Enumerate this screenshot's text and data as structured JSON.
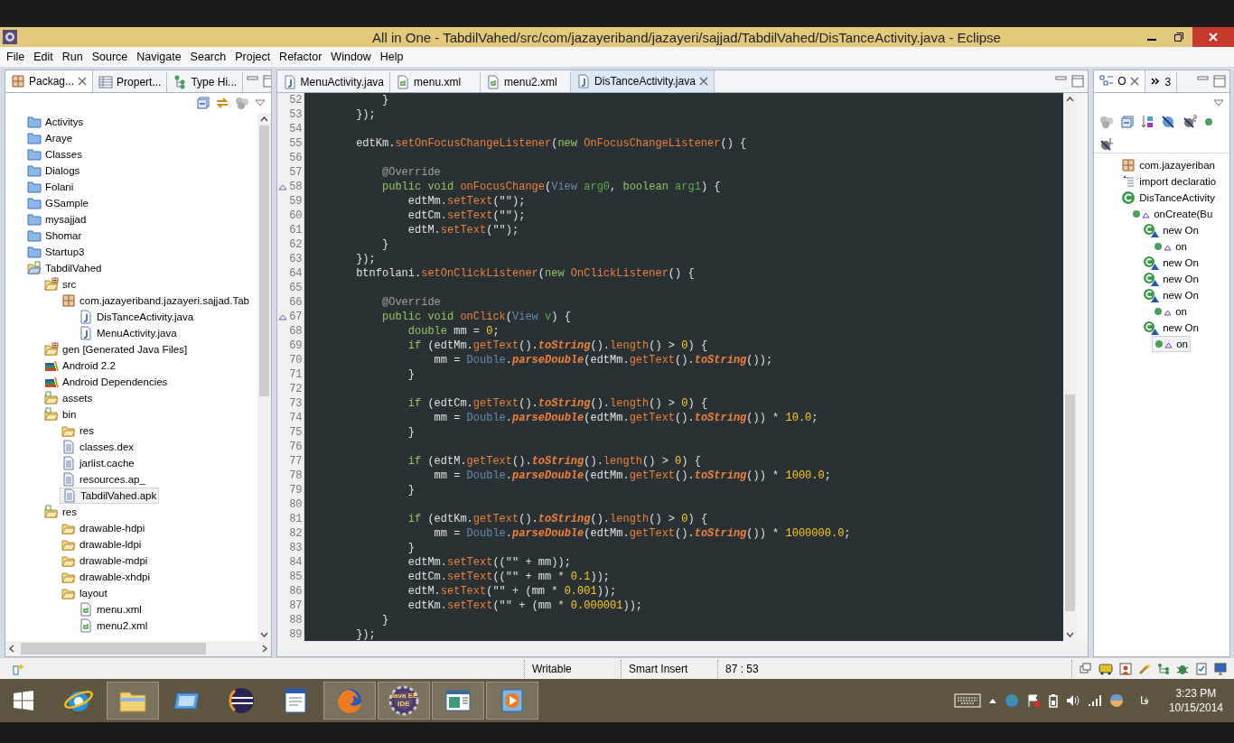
{
  "window": {
    "title": "All in One - TabdilVahed/src/com/jazayeriband/jazayeri/sajjad/TabdilVahed/DisTanceActivity.java - Eclipse",
    "menu": [
      "File",
      "Edit",
      "Run",
      "Source",
      "Navigate",
      "Search",
      "Project",
      "Refactor",
      "Window",
      "Help"
    ]
  },
  "package_explorer": {
    "tabs": [
      {
        "label": "Packag...",
        "kind": "package",
        "selected": true
      },
      {
        "label": "Propert...",
        "kind": "table",
        "selected": false
      },
      {
        "label": "Type Hi...",
        "kind": "hierarchy",
        "selected": false
      }
    ],
    "items": [
      {
        "label": "Activitys",
        "kind": "folder",
        "selected": false
      },
      {
        "label": "Araye",
        "kind": "folder",
        "selected": false
      },
      {
        "label": "Classes",
        "kind": "folder",
        "selected": false
      },
      {
        "label": "Dialogs",
        "kind": "folder",
        "selected": false
      },
      {
        "label": "Folani",
        "kind": "folder",
        "selected": false
      },
      {
        "label": "GSample",
        "kind": "folder",
        "selected": false
      },
      {
        "label": "mysajjad",
        "kind": "folder",
        "selected": false
      },
      {
        "label": "Shomar",
        "kind": "folder",
        "selected": false
      },
      {
        "label": "Startup3",
        "kind": "folder",
        "selected": false
      },
      {
        "label": "TabdilVahed",
        "kind": "project",
        "selected": false,
        "children": [
          {
            "label": "src",
            "kind": "source",
            "selected": false,
            "children": [
              {
                "label": "com.jazayeriband.jazayeri.sajjad.Tab",
                "kind": "package",
                "selected": false,
                "children": [
                  {
                    "label": "DisTanceActivity.java",
                    "kind": "java",
                    "selected": false
                  },
                  {
                    "label": "MenuActivity.java",
                    "kind": "java",
                    "selected": false
                  }
                ]
              }
            ]
          },
          {
            "label": "gen [Generated Java Files]",
            "kind": "source",
            "selected": false
          },
          {
            "label": "Android 2.2",
            "kind": "library",
            "selected": false
          },
          {
            "label": "Android Dependencies",
            "kind": "library",
            "selected": false
          },
          {
            "label": "assets",
            "kind": "resource-folder",
            "selected": false
          },
          {
            "label": "bin",
            "kind": "resource-folder",
            "selected": false,
            "children": [
              {
                "label": "res",
                "kind": "open-folder",
                "selected": false
              },
              {
                "label": "classes.dex",
                "kind": "file",
                "selected": false
              },
              {
                "label": "jarlist.cache",
                "kind": "file",
                "selected": false
              },
              {
                "label": "resources.ap_",
                "kind": "file",
                "selected": false
              },
              {
                "label": "TabdilVahed.apk",
                "kind": "file",
                "selected": true
              }
            ]
          },
          {
            "label": "res",
            "kind": "resource-folder",
            "selected": false,
            "children": [
              {
                "label": "drawable-hdpi",
                "kind": "open-folder",
                "selected": false
              },
              {
                "label": "drawable-ldpi",
                "kind": "open-folder",
                "selected": false
              },
              {
                "label": "drawable-mdpi",
                "kind": "open-folder",
                "selected": false
              },
              {
                "label": "drawable-xhdpi",
                "kind": "open-folder",
                "selected": false
              },
              {
                "label": "layout",
                "kind": "open-folder",
                "selected": false,
                "children": [
                  {
                    "label": "menu.xml",
                    "kind": "xml",
                    "selected": false
                  },
                  {
                    "label": "menu2.xml",
                    "kind": "xml",
                    "selected": false
                  }
                ]
              }
            ]
          }
        ]
      }
    ]
  },
  "editor": {
    "tabs": [
      {
        "label": "MenuActivity.java",
        "kind": "java",
        "selected": false
      },
      {
        "label": "menu.xml",
        "kind": "xml",
        "selected": false
      },
      {
        "label": "menu2.xml",
        "kind": "xml",
        "selected": false
      },
      {
        "label": "DisTanceActivity.java",
        "kind": "java",
        "selected": true
      }
    ],
    "lines": [
      {
        "number": "52",
        "marker": false,
        "tokens": [
          {
            "kind": "plain",
            "text": "            }"
          }
        ]
      },
      {
        "number": "53",
        "marker": false,
        "tokens": [
          {
            "kind": "plain",
            "text": "        });"
          }
        ]
      },
      {
        "number": "54",
        "marker": false
      },
      {
        "number": "55",
        "marker": false,
        "tokens": [
          {
            "kind": "plain",
            "text": "        edtKm."
          },
          {
            "kind": "method",
            "text": "setOnFocusChangeListener"
          },
          {
            "kind": "plain",
            "text": "("
          },
          {
            "kind": "keyword",
            "text": "new "
          },
          {
            "kind": "method",
            "text": "OnFocusChangeListener"
          },
          {
            "kind": "plain",
            "text": "() {"
          }
        ]
      },
      {
        "number": "56",
        "marker": false
      },
      {
        "number": "57",
        "marker": false,
        "tokens": [
          {
            "kind": "annotation",
            "text": "            @Override"
          }
        ]
      },
      {
        "number": "58",
        "marker": true,
        "tokens": [
          {
            "kind": "keyword",
            "text": "            public void "
          },
          {
            "kind": "method",
            "text": "onFocusChange"
          },
          {
            "kind": "plain",
            "text": "("
          },
          {
            "kind": "type",
            "text": "View "
          },
          {
            "kind": "param",
            "text": "arg0"
          },
          {
            "kind": "plain",
            "text": ", "
          },
          {
            "kind": "keyword",
            "text": "boolean "
          },
          {
            "kind": "param",
            "text": "arg1"
          },
          {
            "kind": "plain",
            "text": ") {"
          }
        ]
      },
      {
        "number": "59",
        "marker": false,
        "tokens": [
          {
            "kind": "plain",
            "text": "                edtMm."
          },
          {
            "kind": "method",
            "text": "setText"
          },
          {
            "kind": "plain",
            "text": "(\"\");"
          }
        ]
      },
      {
        "number": "60",
        "marker": false,
        "tokens": [
          {
            "kind": "plain",
            "text": "                edtCm."
          },
          {
            "kind": "method",
            "text": "setText"
          },
          {
            "kind": "plain",
            "text": "(\"\");"
          }
        ]
      },
      {
        "number": "61",
        "marker": false,
        "tokens": [
          {
            "kind": "plain",
            "text": "                edtM."
          },
          {
            "kind": "method",
            "text": "setText"
          },
          {
            "kind": "plain",
            "text": "(\"\");"
          }
        ]
      },
      {
        "number": "62",
        "marker": false,
        "tokens": [
          {
            "kind": "plain",
            "text": "            }"
          }
        ]
      },
      {
        "number": "63",
        "marker": false,
        "tokens": [
          {
            "kind": "plain",
            "text": "        });"
          }
        ]
      },
      {
        "number": "64",
        "marker": false,
        "tokens": [
          {
            "kind": "plain",
            "text": "        btnfolani."
          },
          {
            "kind": "method",
            "text": "setOnClickListener"
          },
          {
            "kind": "plain",
            "text": "("
          },
          {
            "kind": "keyword",
            "text": "new "
          },
          {
            "kind": "method",
            "text": "OnClickListener"
          },
          {
            "kind": "plain",
            "text": "() {"
          }
        ]
      },
      {
        "number": "65",
        "marker": false
      },
      {
        "number": "66",
        "marker": false,
        "tokens": [
          {
            "kind": "annotation",
            "text": "            @Override"
          }
        ]
      },
      {
        "number": "67",
        "marker": true,
        "tokens": [
          {
            "kind": "keyword",
            "text": "            public void "
          },
          {
            "kind": "method",
            "text": "onClick"
          },
          {
            "kind": "plain",
            "text": "("
          },
          {
            "kind": "type",
            "text": "View "
          },
          {
            "kind": "param",
            "text": "v"
          },
          {
            "kind": "plain",
            "text": ") {"
          }
        ]
      },
      {
        "number": "68",
        "marker": false,
        "tokens": [
          {
            "kind": "keyword",
            "text": "                double"
          },
          {
            "kind": "plain",
            "text": " mm = "
          },
          {
            "kind": "number",
            "text": "0"
          },
          {
            "kind": "plain",
            "text": ";"
          }
        ]
      },
      {
        "number": "69",
        "marker": false,
        "tokens": [
          {
            "kind": "keyword",
            "text": "                if"
          },
          {
            "kind": "plain",
            "text": " (edtMm."
          },
          {
            "kind": "method",
            "text": "getText"
          },
          {
            "kind": "plain",
            "text": "()."
          },
          {
            "kind": "static",
            "text": "toString"
          },
          {
            "kind": "plain",
            "text": "()."
          },
          {
            "kind": "method",
            "text": "length"
          },
          {
            "kind": "plain",
            "text": "() > "
          },
          {
            "kind": "number",
            "text": "0"
          },
          {
            "kind": "plain",
            "text": ") {"
          }
        ]
      },
      {
        "number": "70",
        "marker": false,
        "tokens": [
          {
            "kind": "plain",
            "text": "                    mm = "
          },
          {
            "kind": "type",
            "text": "Double"
          },
          {
            "kind": "plain",
            "text": "."
          },
          {
            "kind": "static",
            "text": "parseDouble"
          },
          {
            "kind": "plain",
            "text": "(edtMm."
          },
          {
            "kind": "method",
            "text": "getText"
          },
          {
            "kind": "plain",
            "text": "()."
          },
          {
            "kind": "static",
            "text": "toString"
          },
          {
            "kind": "plain",
            "text": "());"
          }
        ]
      },
      {
        "number": "71",
        "marker": false,
        "tokens": [
          {
            "kind": "plain",
            "text": "                }"
          }
        ]
      },
      {
        "number": "72",
        "marker": false
      },
      {
        "number": "73",
        "marker": false,
        "tokens": [
          {
            "kind": "keyword",
            "text": "                if"
          },
          {
            "kind": "plain",
            "text": " (edtCm."
          },
          {
            "kind": "method",
            "text": "getText"
          },
          {
            "kind": "plain",
            "text": "()."
          },
          {
            "kind": "static",
            "text": "toString"
          },
          {
            "kind": "plain",
            "text": "()."
          },
          {
            "kind": "method",
            "text": "length"
          },
          {
            "kind": "plain",
            "text": "() > "
          },
          {
            "kind": "number",
            "text": "0"
          },
          {
            "kind": "plain",
            "text": ") {"
          }
        ]
      },
      {
        "number": "74",
        "marker": false,
        "tokens": [
          {
            "kind": "plain",
            "text": "                    mm = "
          },
          {
            "kind": "type",
            "text": "Double"
          },
          {
            "kind": "plain",
            "text": "."
          },
          {
            "kind": "static",
            "text": "parseDouble"
          },
          {
            "kind": "plain",
            "text": "(edtMm."
          },
          {
            "kind": "method",
            "text": "getText"
          },
          {
            "kind": "plain",
            "text": "()."
          },
          {
            "kind": "static",
            "text": "toString"
          },
          {
            "kind": "plain",
            "text": "()) * "
          },
          {
            "kind": "number",
            "text": "10.0"
          },
          {
            "kind": "plain",
            "text": ";"
          }
        ]
      },
      {
        "number": "75",
        "marker": false,
        "tokens": [
          {
            "kind": "plain",
            "text": "                }"
          }
        ]
      },
      {
        "number": "76",
        "marker": false
      },
      {
        "number": "77",
        "marker": false,
        "tokens": [
          {
            "kind": "keyword",
            "text": "                if"
          },
          {
            "kind": "plain",
            "text": " (edtM."
          },
          {
            "kind": "method",
            "text": "getText"
          },
          {
            "kind": "plain",
            "text": "()."
          },
          {
            "kind": "static",
            "text": "toString"
          },
          {
            "kind": "plain",
            "text": "()."
          },
          {
            "kind": "method",
            "text": "length"
          },
          {
            "kind": "plain",
            "text": "() > "
          },
          {
            "kind": "number",
            "text": "0"
          },
          {
            "kind": "plain",
            "text": ") {"
          }
        ]
      },
      {
        "number": "78",
        "marker": false,
        "tokens": [
          {
            "kind": "plain",
            "text": "                    mm = "
          },
          {
            "kind": "type",
            "text": "Double"
          },
          {
            "kind": "plain",
            "text": "."
          },
          {
            "kind": "static",
            "text": "parseDouble"
          },
          {
            "kind": "plain",
            "text": "(edtMm."
          },
          {
            "kind": "method",
            "text": "getText"
          },
          {
            "kind": "plain",
            "text": "()."
          },
          {
            "kind": "static",
            "text": "toString"
          },
          {
            "kind": "plain",
            "text": "()) * "
          },
          {
            "kind": "number",
            "text": "1000.0"
          },
          {
            "kind": "plain",
            "text": ";"
          }
        ]
      },
      {
        "number": "79",
        "marker": false,
        "tokens": [
          {
            "kind": "plain",
            "text": "                }"
          }
        ]
      },
      {
        "number": "80",
        "marker": false
      },
      {
        "number": "81",
        "marker": false,
        "tokens": [
          {
            "kind": "keyword",
            "text": "                if"
          },
          {
            "kind": "plain",
            "text": " (edtKm."
          },
          {
            "kind": "method",
            "text": "getText"
          },
          {
            "kind": "plain",
            "text": "()."
          },
          {
            "kind": "static",
            "text": "toString"
          },
          {
            "kind": "plain",
            "text": "()."
          },
          {
            "kind": "method",
            "text": "length"
          },
          {
            "kind": "plain",
            "text": "() > "
          },
          {
            "kind": "number",
            "text": "0"
          },
          {
            "kind": "plain",
            "text": ") {"
          }
        ]
      },
      {
        "number": "82",
        "marker": false,
        "tokens": [
          {
            "kind": "plain",
            "text": "                    mm = "
          },
          {
            "kind": "type",
            "text": "Double"
          },
          {
            "kind": "plain",
            "text": "."
          },
          {
            "kind": "static",
            "text": "parseDouble"
          },
          {
            "kind": "plain",
            "text": "(edtMm."
          },
          {
            "kind": "method",
            "text": "getText"
          },
          {
            "kind": "plain",
            "text": "()."
          },
          {
            "kind": "static",
            "text": "toString"
          },
          {
            "kind": "plain",
            "text": "()) * "
          },
          {
            "kind": "number",
            "text": "1000000.0"
          },
          {
            "kind": "plain",
            "text": ";"
          }
        ]
      },
      {
        "number": "83",
        "marker": false,
        "tokens": [
          {
            "kind": "plain",
            "text": "                }"
          }
        ]
      },
      {
        "number": "84",
        "marker": false,
        "tokens": [
          {
            "kind": "plain",
            "text": "                edtMm."
          },
          {
            "kind": "method",
            "text": "setText"
          },
          {
            "kind": "plain",
            "text": "((\"\" + mm));"
          }
        ]
      },
      {
        "number": "85",
        "marker": false,
        "tokens": [
          {
            "kind": "plain",
            "text": "                edtCm."
          },
          {
            "kind": "method",
            "text": "setText"
          },
          {
            "kind": "plain",
            "text": "((\"\" + mm * "
          },
          {
            "kind": "number",
            "text": "0.1"
          },
          {
            "kind": "plain",
            "text": "));"
          }
        ]
      },
      {
        "number": "86",
        "marker": false,
        "tokens": [
          {
            "kind": "plain",
            "text": "                edtM."
          },
          {
            "kind": "method",
            "text": "setText"
          },
          {
            "kind": "plain",
            "text": "(\"\" + (mm * "
          },
          {
            "kind": "number",
            "text": "0.001"
          },
          {
            "kind": "plain",
            "text": "));"
          }
        ]
      },
      {
        "number": "87",
        "marker": false,
        "tokens": [
          {
            "kind": "plain",
            "text": "                edtKm."
          },
          {
            "kind": "method",
            "text": "setText"
          },
          {
            "kind": "plain",
            "text": "(\"\" + (mm * "
          },
          {
            "kind": "number",
            "text": "0.000001"
          },
          {
            "kind": "plain",
            "text": "));"
          }
        ]
      },
      {
        "number": "88",
        "marker": false,
        "tokens": [
          {
            "kind": "plain",
            "text": "            }"
          }
        ]
      },
      {
        "number": "89",
        "marker": false,
        "tokens": [
          {
            "kind": "plain",
            "text": "        });"
          }
        ]
      }
    ]
  },
  "outline": {
    "tabs": [
      {
        "label": "O",
        "kind": "outline",
        "selected": true
      },
      {
        "label": "3",
        "kind": "chevron",
        "selected": false
      }
    ],
    "items": [
      {
        "label": "com.jazayeriban",
        "kind": "package",
        "selected": false
      },
      {
        "label": "import declaratio",
        "kind": "imports",
        "selected": false
      },
      {
        "label": "DisTanceActivity",
        "kind": "class",
        "selected": false,
        "children": [
          {
            "label": "onCreate(Bu",
            "kind": "method",
            "selected": false,
            "children": [
              {
                "label": "new On",
                "kind": "anon-class",
                "selected": false,
                "children": [
                  {
                    "label": "on",
                    "kind": "method",
                    "selected": false
                  }
                ]
              },
              {
                "label": "new On",
                "kind": "anon-class",
                "selected": false
              },
              {
                "label": "new On",
                "kind": "anon-class",
                "selected": false
              },
              {
                "label": "new On",
                "kind": "anon-class",
                "selected": false,
                "children": [
                  {
                    "label": "on",
                    "kind": "method",
                    "selected": false
                  }
                ]
              },
              {
                "label": "new On",
                "kind": "anon-class",
                "selected": false,
                "children": [
                  {
                    "label": "on",
                    "kind": "method",
                    "selected": true
                  }
                ]
              }
            ]
          }
        ]
      }
    ]
  },
  "status_bar": {
    "mode": "Writable",
    "insert_mode": "Smart Insert",
    "position": "87 : 53"
  },
  "taskbar": {
    "apps": [
      {
        "kind": "ie",
        "running": false
      },
      {
        "kind": "explorer",
        "running": true
      },
      {
        "kind": "tablet",
        "running": false
      },
      {
        "kind": "eclipse",
        "running": false
      },
      {
        "kind": "document",
        "running": false
      },
      {
        "kind": "firefox",
        "running": true
      },
      {
        "kind": "javaee",
        "running": true,
        "caption": [
          "Java EE",
          "IDE"
        ]
      },
      {
        "kind": "window",
        "running": true
      },
      {
        "kind": "media",
        "running": true
      }
    ],
    "language": "فا",
    "time": "3:23 PM",
    "date": "10/15/2014"
  }
}
